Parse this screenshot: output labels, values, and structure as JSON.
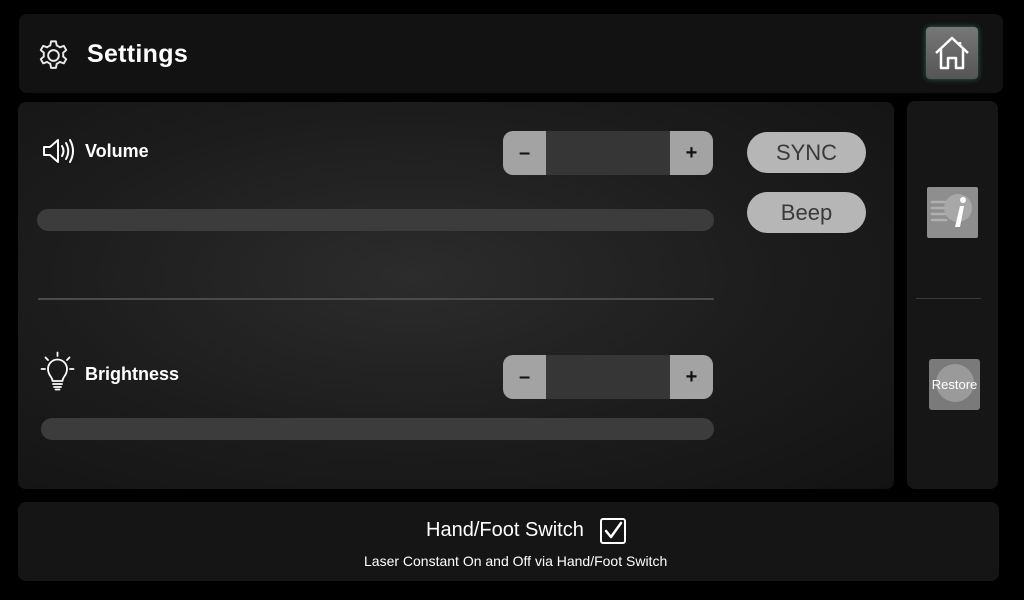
{
  "header": {
    "title": "Settings",
    "icon": "gear-icon",
    "home_icon": "home-icon"
  },
  "volume": {
    "label": "Volume",
    "icon": "speaker-icon",
    "minus": "–",
    "plus": "+",
    "value": "",
    "level": 0
  },
  "brightness": {
    "label": "Brightness",
    "icon": "lightbulb-icon",
    "minus": "–",
    "plus": "+",
    "value": "",
    "level": 0
  },
  "buttons": {
    "sync": "SYNC",
    "beep": "Beep",
    "restore": "Restore",
    "info_icon": "info-icon"
  },
  "footer": {
    "switch_label": "Hand/Foot Switch",
    "switch_checked": true,
    "description": "Laser Constant On  and Off via Hand/Foot Switch"
  },
  "colors": {
    "background": "#000000",
    "panel": "#141414",
    "button": "#b6b6b6",
    "stepper_button": "#a3a3a3"
  }
}
